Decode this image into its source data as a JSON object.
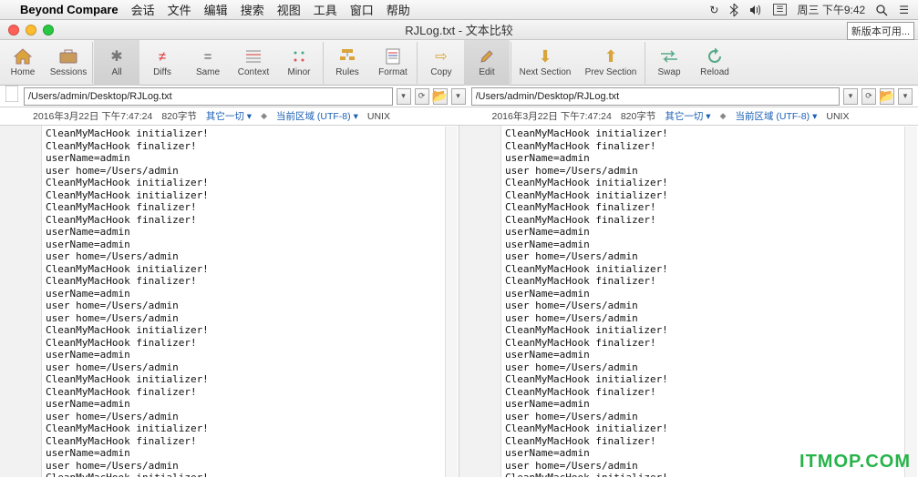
{
  "menubar": {
    "app_name": "Beyond Compare",
    "items": [
      "会话",
      "文件",
      "编辑",
      "搜索",
      "视图",
      "工具",
      "窗口",
      "帮助"
    ],
    "status_time": "周三 下午9:42"
  },
  "titlebar": {
    "title": "RJLog.txt - 文本比较",
    "notice": "新版本可用..."
  },
  "toolbar": {
    "items": [
      "Home",
      "Sessions",
      "All",
      "Diffs",
      "Same",
      "Context",
      "Minor",
      "Rules",
      "Format",
      "Copy",
      "Edit",
      "Next Section",
      "Prev Section",
      "Swap",
      "Reload"
    ]
  },
  "path": "/Users/admin/Desktop/RJLog.txt",
  "info": {
    "timestamp": "2016年3月22日 下午7:47:24",
    "size": "820字节",
    "other": "其它一切",
    "encoding": "当前区域 (UTF-8)",
    "lineend": "UNIX"
  },
  "file_lines": [
    "CleanMyMacHook initializer!",
    "CleanMyMacHook finalizer!",
    "userName=admin",
    "user home=/Users/admin",
    "CleanMyMacHook initializer!",
    "CleanMyMacHook initializer!",
    "CleanMyMacHook finalizer!",
    "CleanMyMacHook finalizer!",
    "userName=admin",
    "userName=admin",
    "user home=/Users/admin",
    "CleanMyMacHook initializer!",
    "CleanMyMacHook finalizer!",
    "userName=admin",
    "user home=/Users/admin",
    "user home=/Users/admin",
    "CleanMyMacHook initializer!",
    "CleanMyMacHook finalizer!",
    "userName=admin",
    "user home=/Users/admin",
    "CleanMyMacHook initializer!",
    "CleanMyMacHook finalizer!",
    "userName=admin",
    "user home=/Users/admin",
    "CleanMyMacHook initializer!",
    "CleanMyMacHook finalizer!",
    "userName=admin",
    "user home=/Users/admin",
    "CleanMyMacHook initializer!"
  ],
  "watermark": "ITMOP.COM"
}
